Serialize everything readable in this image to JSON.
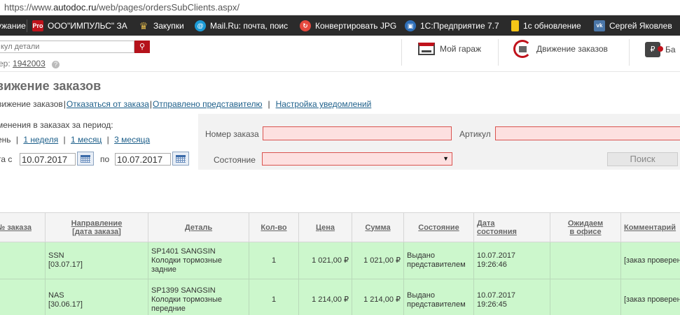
{
  "browser": {
    "url_prefix": "https://www.",
    "url_host": "autodoc.ru",
    "url_path": "/web/pages/ordersSubClients.aspx/"
  },
  "bookmarks": [
    {
      "label": "ужание",
      "icon": ""
    },
    {
      "label": "ООО\"ИМПУЛЬС\" ЗА",
      "icon": "Pro"
    },
    {
      "label": "Закупки",
      "icon": "eagle"
    },
    {
      "label": "Mail.Ru: почта, поис",
      "icon": "@"
    },
    {
      "label": "Конвертировать JPG",
      "icon": "convert"
    },
    {
      "label": "1С:Предприятие 7.7",
      "icon": "1c"
    },
    {
      "label": "1с обновление",
      "icon": "doc"
    },
    {
      "label": "Сергей Яковлев",
      "icon": "vk"
    }
  ],
  "bookmark_icons": {
    "pro": "Pro",
    "mail": "@",
    "vk": "vk"
  },
  "header": {
    "search_placeholder": "кул детали",
    "client_label": "ер:",
    "client_number": "1942003",
    "garage_label": "Мой гараж",
    "orders_label": "Движение заказов",
    "balance_label": "Ба",
    "balance_glyph": "₽"
  },
  "page": {
    "title": "вижение заказов",
    "links": {
      "current": "вижение заказов",
      "cancel": "Отказаться от заказа",
      "sent": "Отправлено представителю",
      "notify": "Настройка уведомлений"
    },
    "period_label": "менения в заказах за период:",
    "period_day": "ень",
    "period_week": "1 неделя",
    "period_month": "1 месяц",
    "period_3month": "3 месяца",
    "date_from_label": "та с",
    "date_from": "10.07.2017",
    "date_to_label": "по",
    "date_to": "10.07.2017"
  },
  "filters": {
    "order_number_label": "Номер заказа",
    "order_number_value": "",
    "article_label": "Артикул",
    "article_value": "",
    "state_label": "Состояние",
    "state_value": "",
    "search_button": "Поиск"
  },
  "table": {
    "columns": {
      "order_no": "№ заказа",
      "direction": "Направление [дата заказа]",
      "part": "Деталь",
      "qty": "Кол-во",
      "price": "Цена",
      "sum": "Сумма",
      "state": "Состояние",
      "state_date": "Дата состояния",
      "expected": "Ожидаем в офисе",
      "comment": "Комментарий"
    },
    "rows": [
      {
        "order_no": "",
        "direction": "SSN",
        "order_date": "[03.07.17]",
        "part": "SP1401 SANGSIN Колодки тормозные задние",
        "qty": "1",
        "price": "1 021,00 ₽",
        "sum": "1 021,00 ₽",
        "state": "Выдано представителем",
        "state_date": "10.07.2017",
        "state_time": "19:26:46",
        "expected": "",
        "comment": "[заказ проверен]"
      },
      {
        "order_no": "",
        "direction": "NAS",
        "order_date": "[30.06.17]",
        "part": "SP1399 SANGSIN Колодки тормозные передние",
        "qty": "1",
        "price": "1 214,00 ₽",
        "sum": "1 214,00 ₽",
        "state": "Выдано представителем",
        "state_date": "10.07.2017",
        "state_time": "19:26:45",
        "expected": "",
        "comment": "[заказ проверен]"
      }
    ]
  }
}
